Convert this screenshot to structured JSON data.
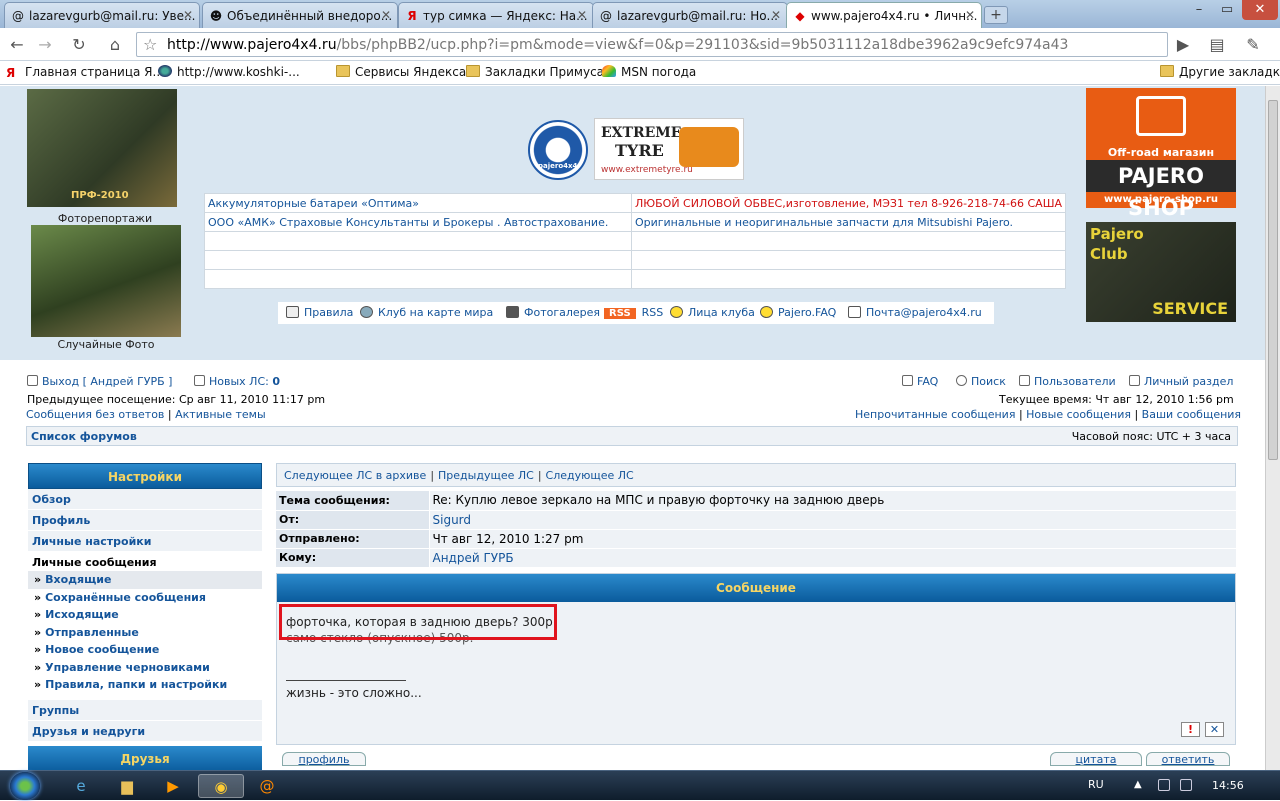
{
  "browser": {
    "tabs": [
      {
        "icon": "@",
        "title": "lazarevgurb@mail.ru: Уве..."
      },
      {
        "icon": "☻",
        "title": "Объединённый внедоро..."
      },
      {
        "icon": "Я",
        "title": "тур симка — Яндекс: На..."
      },
      {
        "icon": "@",
        "title": "lazarevgurb@mail.ru: Но..."
      },
      {
        "icon": "◆",
        "title": "www.pajero4x4.ru • Личн..."
      }
    ],
    "url_host": "http://www.pajero4x4.ru",
    "url_path": "/bbs/phpBB2/ucp.php?i=pm&mode=view&f=0&p=291103&sid=9b5031112a18dbe3962a9c9efc974a43",
    "bookmarks": [
      {
        "icon": "Я",
        "label": "Главная страница Я..."
      },
      {
        "icon": "globe",
        "label": "http://www.koshki-..."
      },
      {
        "icon": "folder",
        "label": "Сервисы Яндекса"
      },
      {
        "icon": "folder",
        "label": "Закладки Примуса"
      },
      {
        "icon": "msn",
        "label": "MSN погода"
      }
    ],
    "other_bookmarks": "Другие закладки"
  },
  "header": {
    "photo1_label": "ПРФ-2010",
    "caption1": "Фоторепортажи",
    "caption2": "Случайные Фото",
    "logo1_text": "pajero4x4",
    "logo2_title1": "EXTREME",
    "logo2_title2": "TYRE",
    "logo2_url": "www.extremetyre.ru",
    "ads": [
      [
        "Аккумуляторные батареи «Оптима»",
        "ЛЮБОЙ СИЛОВОЙ ОБВЕС,изготовление, МЭЗ1 тел 8-926-218-74-66 САША"
      ],
      [
        "ООО «АМК» Страховые Консультанты и Брокеры . Автострахование.",
        "Оригинальные и неоригинальные запчасти для Mitsubishi Pajero."
      ],
      [
        "",
        ""
      ],
      [
        "",
        ""
      ],
      [
        "",
        ""
      ]
    ],
    "iconbar": {
      "rules": "Правила",
      "map": "Клуб на карте мира",
      "gallery": "Фотогалерея",
      "rss_badge": "RSS",
      "rss": "RSS",
      "faces": "Лица клуба",
      "faq": "Pajero.FAQ",
      "mail": "Почта@pajero4x4.ru"
    },
    "shop": {
      "subtitle": "Off-road магазин",
      "title": "PAJERO SHOP",
      "url": "www.pajero-shop.ru"
    },
    "club": {
      "line1": "Pajero",
      "line2": "Club",
      "service": "SERVICE"
    }
  },
  "userbar": {
    "logout": "Выход [ Андрей ГУРБ ]",
    "new_pm_label": "Новых ЛС:",
    "new_pm_count": "0",
    "last_visit": "Предыдущее посещение: Ср авг 11, 2010 11:17 pm",
    "unanswered": "Сообщения без ответов",
    "active": "Активные темы",
    "faq": "FAQ",
    "search": "Поиск",
    "users": "Пользователи",
    "ucp": "Личный раздел",
    "current_time": "Текущее время: Чт авг 12, 2010 1:56 pm",
    "unread": "Непрочитанные сообщения",
    "new_posts": "Новые сообщения",
    "your_posts": "Ваши сообщения",
    "forum_index": "Список форумов",
    "timezone": "Часовой пояс: UTC + 3 часа"
  },
  "sidebar": {
    "header": "Настройки",
    "items": [
      "Обзор",
      "Профиль",
      "Личные настройки"
    ],
    "pm_section": "Личные сообщения",
    "pm_items": [
      "Входящие",
      "Сохранённые сообщения",
      "Исходящие",
      "Отправленные",
      "Новое сообщение",
      "Управление черновиками",
      "Правила, папки и настройки"
    ],
    "bottom_items": [
      "Группы",
      "Друзья и недруги"
    ],
    "friends": "Друзья"
  },
  "message": {
    "nav": [
      "Следующее ЛС в архиве",
      "Предыдущее ЛС",
      "Следующее ЛС"
    ],
    "subject_label": "Тема сообщения:",
    "subject": "Re: Куплю левое зеркало на МПС и правую форточку на заднюю дверь",
    "from_label": "От:",
    "from": "Sigurd",
    "sent_label": "Отправлено:",
    "sent": "Чт авг 12, 2010 1:27 pm",
    "to_label": "Кому:",
    "to": "Андрей ГУРБ",
    "header": "Сообщение",
    "line1": "форточка, которая в заднюю дверь? 300р.",
    "line2": "само стекло (опускное) 500р.",
    "signature": "жизнь - это сложно...",
    "report": "!",
    "delete": "✕",
    "profile_btn": "профиль",
    "quote_btn": "цитата",
    "reply_btn": "ответить"
  },
  "taskbar": {
    "lang": "RU",
    "time": "14:56"
  }
}
